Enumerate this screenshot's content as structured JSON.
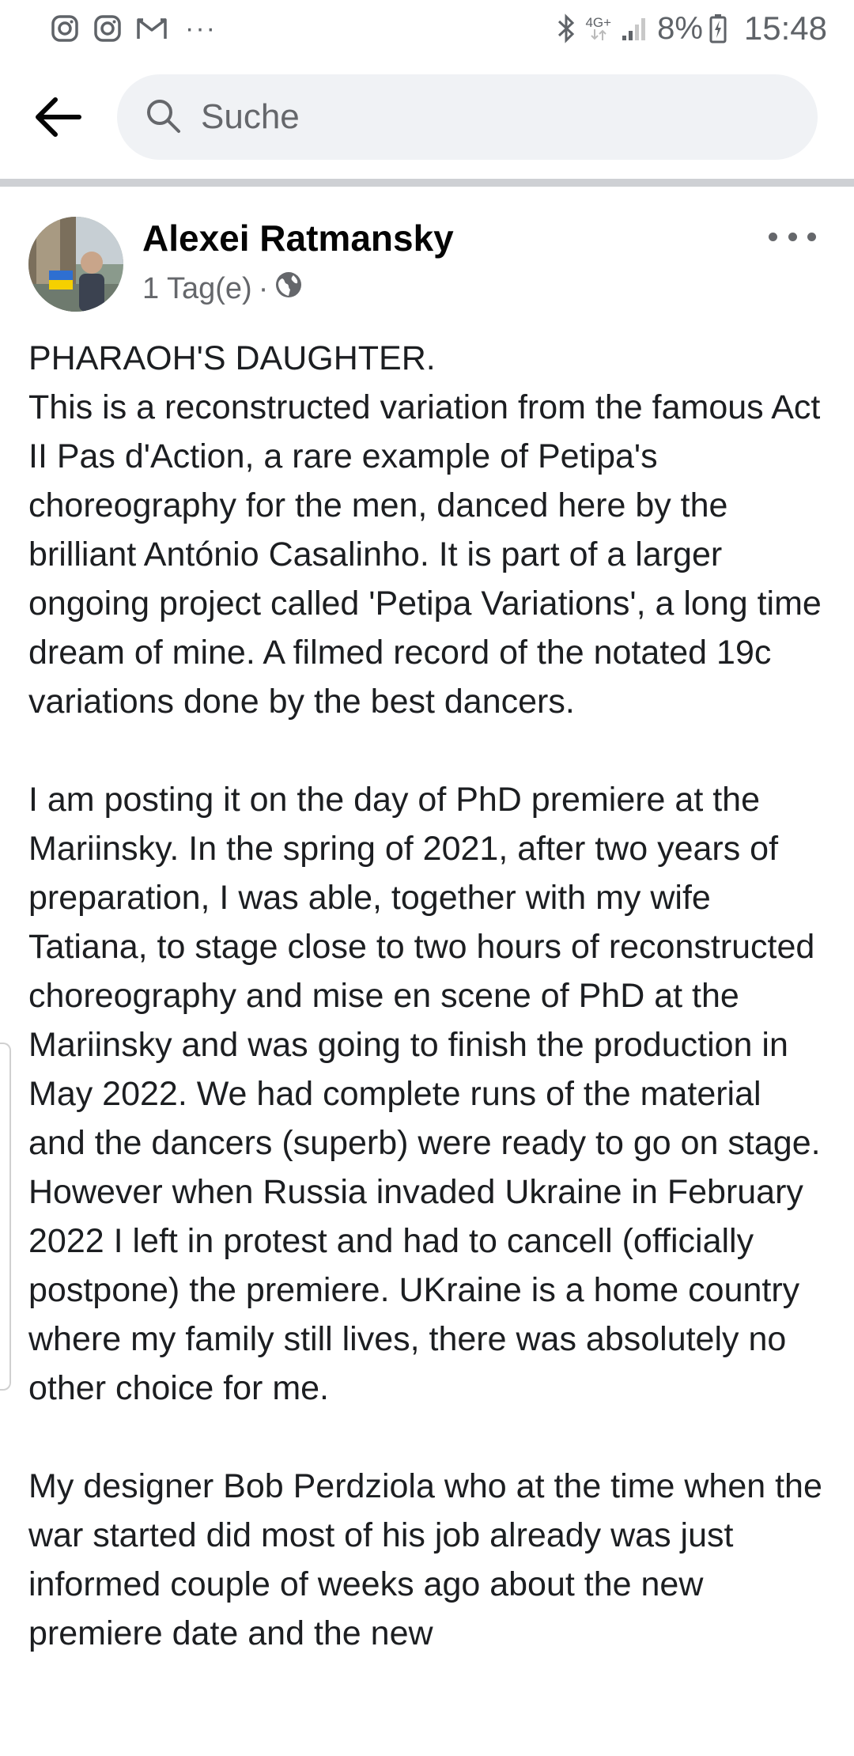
{
  "status_bar": {
    "left_icons": [
      "instagram-icon",
      "instagram-icon",
      "gmail-icon"
    ],
    "more_notifications": "···",
    "network": "4G+",
    "battery": "8%",
    "time": "15:48"
  },
  "search": {
    "placeholder": "Suche"
  },
  "post": {
    "author": "Alexei Ratmansky",
    "time_ago": "1 Tag(e)",
    "separator": "·",
    "audience_icon": "globe-icon",
    "paragraphs": [
      "PHARAOH'S DAUGHTER.\nThis is a reconstructed variation from the famous Act II Pas d'Action, a rare example of Petipa's choreography for the men, danced here by the brilliant António Casalinho. It is part of a larger ongoing project called 'Petipa Variations', a long time dream of mine. A filmed record of the notated 19c variations done by the best dancers.",
      "I am posting it on the day of PhD premiere at the Mariinsky. In the spring of 2021, after two years of preparation, I was able, together with my wife Tatiana, to stage close to two hours of reconstructed choreography and mise en scene of PhD at the Mariinsky and was going to finish the production in May 2022. We had complete runs of the material and the dancers (superb) were ready to go on stage. However when Russia invaded Ukraine in February 2022 I left in protest and had to cancell (officially postpone) the premiere. UKraine is a home country where my family still lives, there was absolutely no other choice for me.",
      "My designer Bob Perdziola who at the time when the war started did most of his job already was just informed couple of weeks ago about the new premiere date and the new"
    ]
  }
}
